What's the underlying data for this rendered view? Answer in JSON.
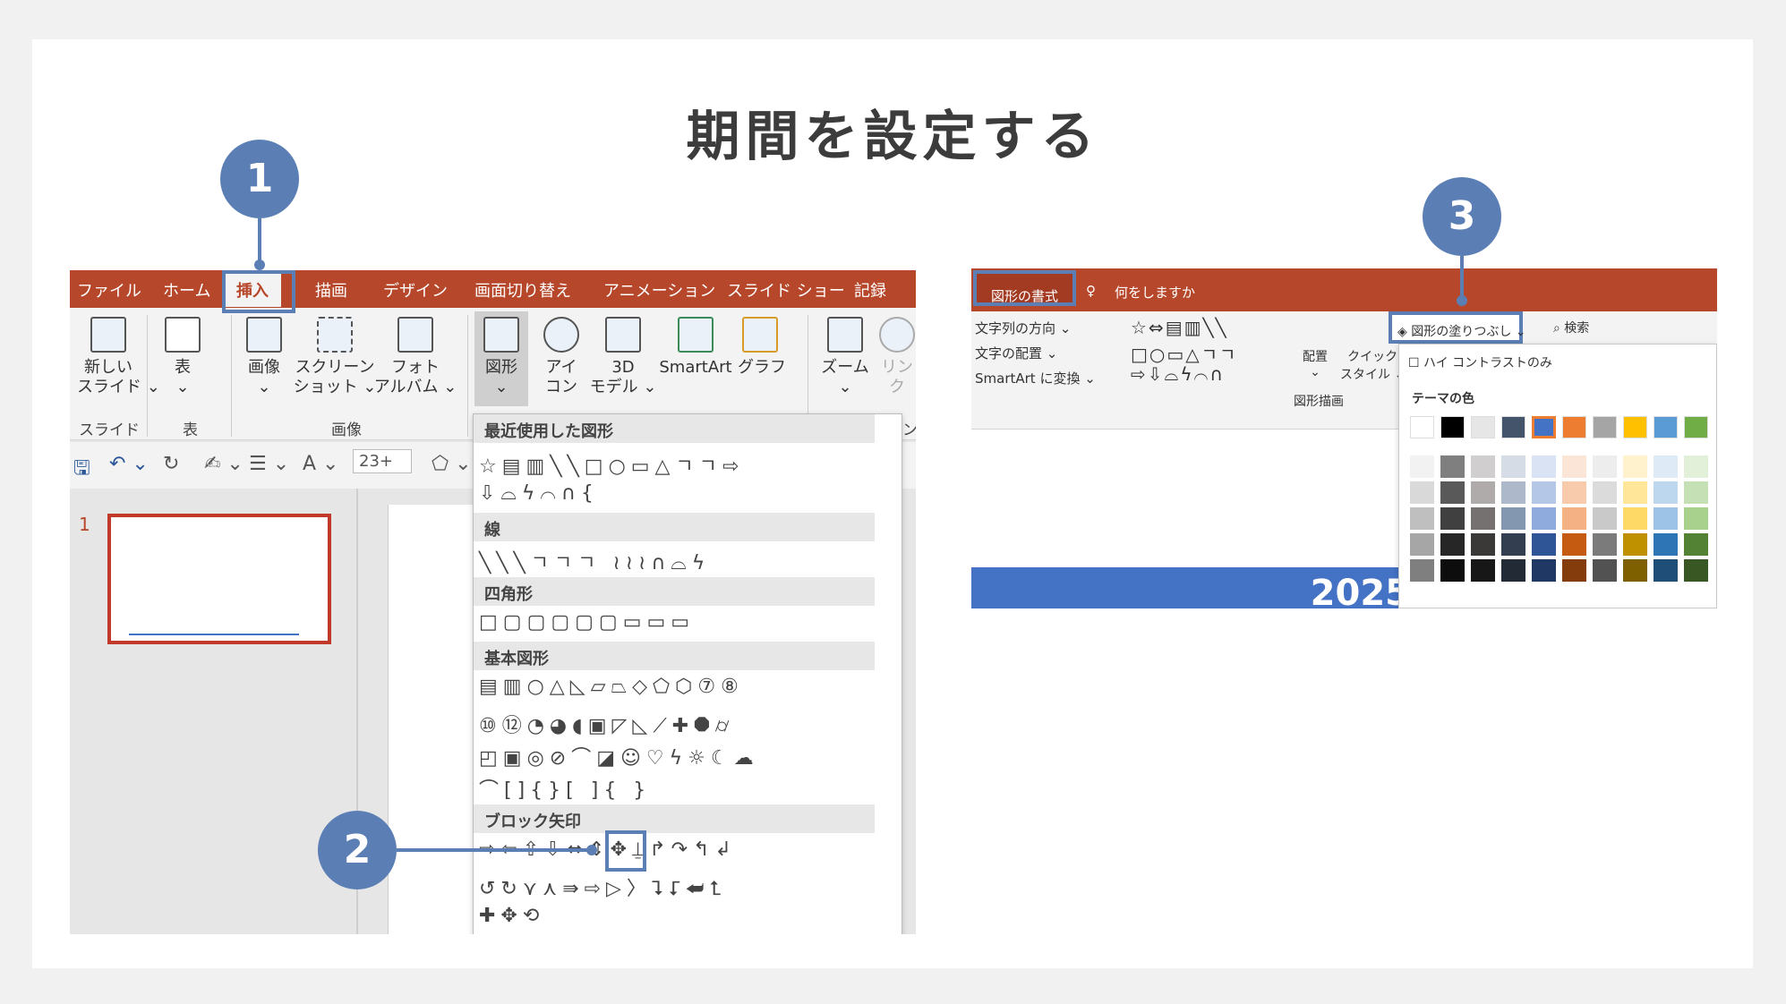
{
  "page": {
    "title": "期間を設定する"
  },
  "callouts": [
    "1",
    "2",
    "3"
  ],
  "left": {
    "tabs": [
      "ファイル",
      "ホーム",
      "挿入",
      "描画",
      "デザイン",
      "画面切り替え",
      "アニメーション",
      "スライド ショー",
      "記録"
    ],
    "buttons": [
      {
        "label": "新しい\nスライド ⌄",
        "icon": "new-slide-icon"
      },
      {
        "label": "表\n⌄",
        "icon": "table-icon"
      },
      {
        "label": "画像\n⌄",
        "icon": "picture-icon"
      },
      {
        "label": "スクリーン\nショット ⌄",
        "icon": "screenshot-icon"
      },
      {
        "label": "フォト\nアルバム ⌄",
        "icon": "photo-album-icon"
      },
      {
        "label": "図形\n⌄",
        "icon": "shapes-icon"
      },
      {
        "label": "アイ\nコン",
        "icon": "icons-icon"
      },
      {
        "label": "3D\nモデル ⌄",
        "icon": "3d-model-icon"
      },
      {
        "label": "SmartArt",
        "icon": "smartart-icon"
      },
      {
        "label": "グラフ",
        "icon": "chart-icon"
      },
      {
        "label": "ズーム\n⌄",
        "icon": "zoom-icon"
      },
      {
        "label": "リン\nク",
        "icon": "link-icon"
      }
    ],
    "groups": [
      "スライド",
      "表",
      "画像",
      "ン"
    ],
    "qat": {
      "save": "🖫",
      "undo": "↶ ⌄",
      "redo": "↻",
      "format": "✍ ⌄",
      "list": "☰ ⌄",
      "font": "A ⌄",
      "size": "23+",
      "shape": "⬠ ⌄"
    },
    "slide_number": "1",
    "shapes_panel": {
      "sections": [
        "最近使用した図形",
        "線",
        "四角形",
        "基本図形",
        "ブロック矢印"
      ],
      "rows": [
        "☆▤▥╲╲□○▭△ㄱㄱ⇨",
        "⇩⌓ϟ⌒∩{",
        "╲╲╲ㄱㄱㄱ ≀≀≀∩⌓ϟ",
        "□▢▢▢▢▢▭▭▭",
        "▤▥○△◺▱⏢◇⬠⬡⑦⑧",
        "⑩⑫◔◕◖▣◸◺⟋✚⯃⌭",
        "◰▣◎⊘⌒◪☺♡ϟ☼☾☁",
        "⌒[]{}[ ]{ }",
        "⇨⇦⇧⇩⇔⇕✥⍊↱↷↰↲",
        "↺↻⋎⋏⇛⇨▷〉⮧⮦⮨⮤",
        "✚✥⟲"
      ]
    }
  },
  "right": {
    "tabs": [
      "図形の書式",
      "何をしますか"
    ],
    "list_items": [
      "文字列の方向 ⌄",
      "文字の配置 ⌄",
      "SmartArt に変換 ⌄"
    ],
    "shape_glyphs": [
      "☆⇔▤▥╲╲",
      "□○▭△ㄱㄱ",
      "⇨⇩⌓ϟ⌒∩"
    ],
    "buttons": [
      "配置\n⌄",
      "クイック\nスタイル ⌄"
    ],
    "group_label": "図形描画",
    "fill_button": "図形の塗りつぶし ⌄",
    "search": "検索",
    "high_contrast": "ハイ コントラストのみ",
    "theme_colors_label": "テーマの色",
    "theme_row": [
      "#ffffff",
      "#000000",
      "#e7e6e6",
      "#44546a",
      "#4472c4",
      "#ed7d31",
      "#a5a5a5",
      "#ffc000",
      "#5b9bd5",
      "#70ad47"
    ],
    "shades": [
      [
        "#f2f2f2",
        "#7f7f7f",
        "#d0cece",
        "#d6dce5",
        "#dae3f3",
        "#fbe5d6",
        "#ededed",
        "#fff2cc",
        "#deebf7",
        "#e2f0d9"
      ],
      [
        "#d9d9d9",
        "#595959",
        "#afabab",
        "#adb9ca",
        "#b4c7e7",
        "#f8cbad",
        "#dbdbdb",
        "#ffe699",
        "#bdd7ee",
        "#c5e0b4"
      ],
      [
        "#bfbfbf",
        "#404040",
        "#767171",
        "#8497b0",
        "#8faadc",
        "#f4b183",
        "#c9c9c9",
        "#ffd966",
        "#9dc3e6",
        "#a9d18e"
      ],
      [
        "#a6a6a6",
        "#262626",
        "#3b3838",
        "#333f50",
        "#2f5597",
        "#c55a11",
        "#7b7b7b",
        "#bf9000",
        "#2e75b6",
        "#548235"
      ],
      [
        "#7f7f7f",
        "#0d0d0d",
        "#171717",
        "#222a35",
        "#203864",
        "#843c0c",
        "#525252",
        "#7f6000",
        "#1f4e79",
        "#385723"
      ]
    ],
    "year_partial": "2025"
  }
}
